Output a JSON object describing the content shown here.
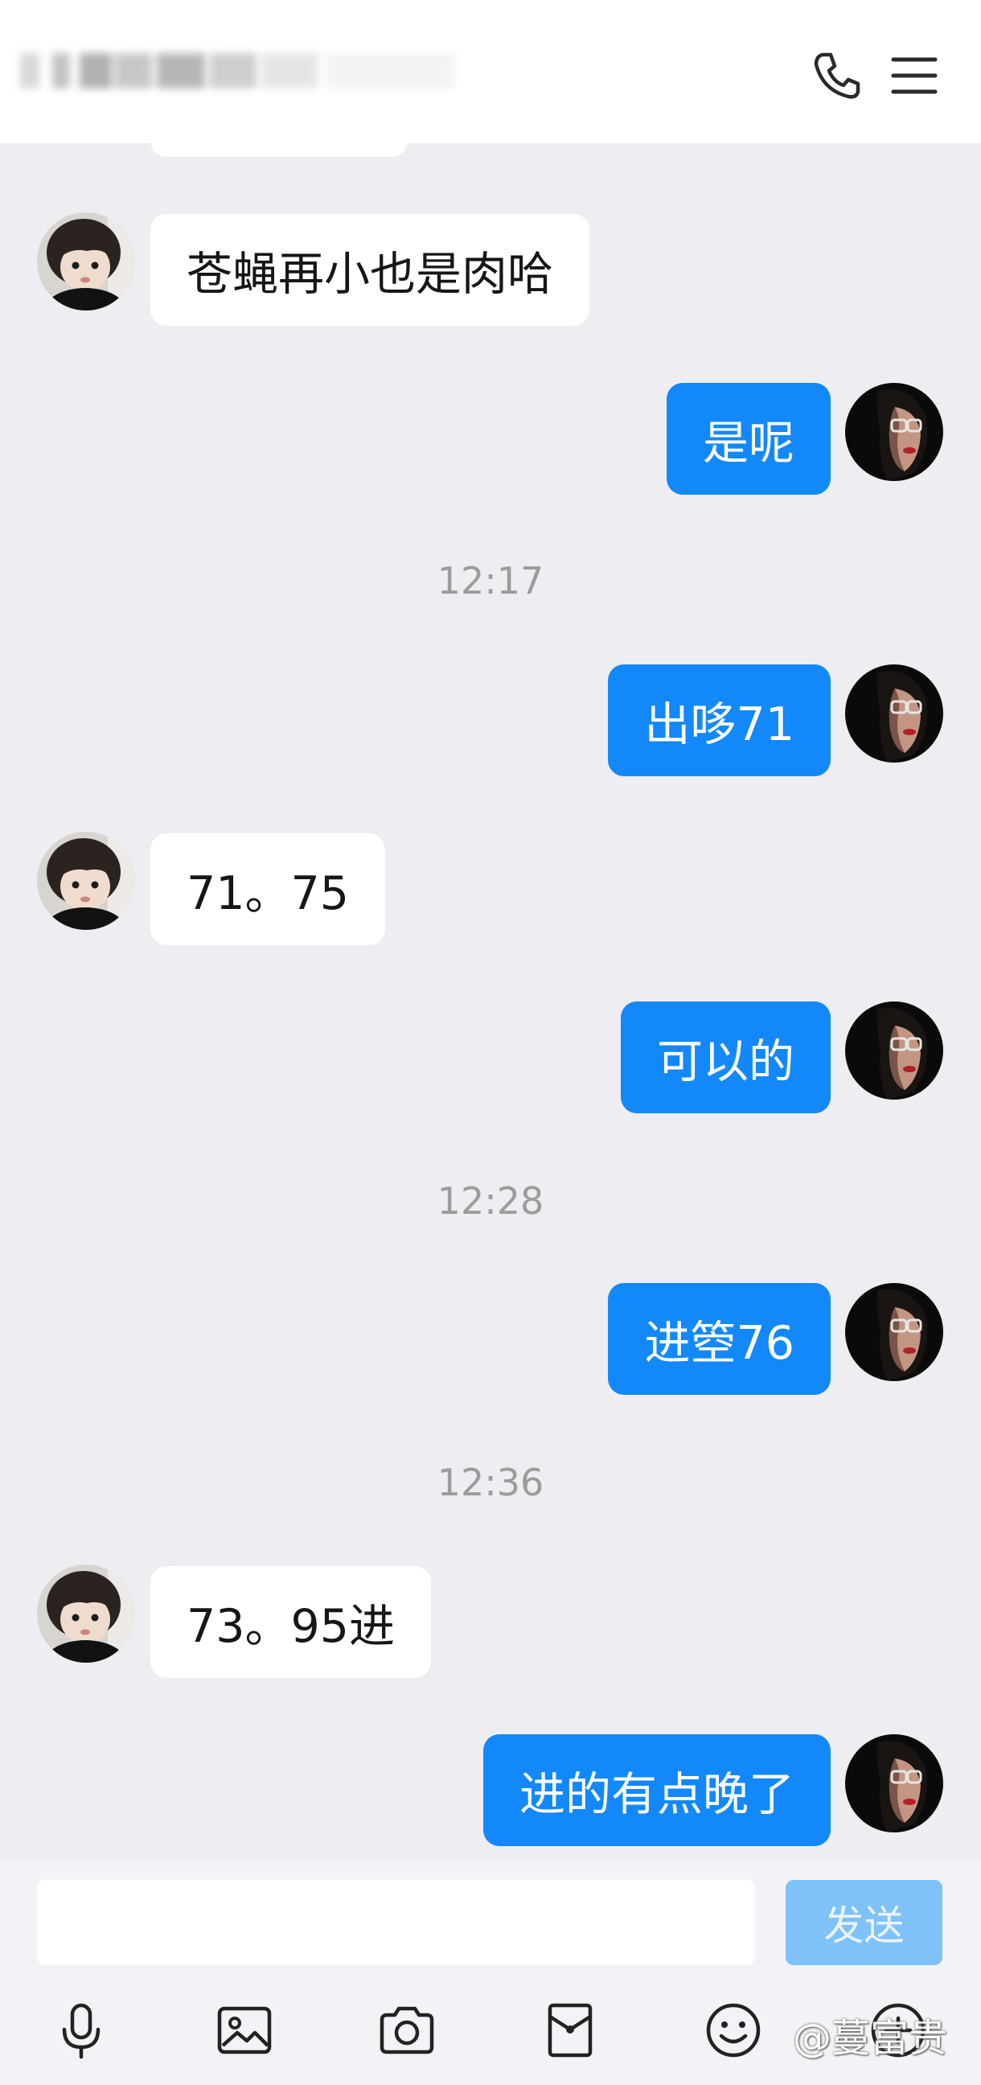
{
  "header": {
    "title_redacted": true,
    "phone_icon": "phone-icon",
    "menu_icon": "menu-icon"
  },
  "messages": [
    {
      "type": "partial",
      "side": "left",
      "text": ""
    },
    {
      "type": "message",
      "side": "left",
      "text": "苍蝇再小也是肉哈"
    },
    {
      "type": "message",
      "side": "right",
      "text": "是呢"
    },
    {
      "type": "time",
      "text": "12:17"
    },
    {
      "type": "message",
      "side": "right",
      "text": "出哆71"
    },
    {
      "type": "message",
      "side": "left",
      "text": "71。75"
    },
    {
      "type": "message",
      "side": "right",
      "text": "可以的"
    },
    {
      "type": "time",
      "text": "12:28"
    },
    {
      "type": "message",
      "side": "right",
      "text": "进箜76"
    },
    {
      "type": "time",
      "text": "12:36"
    },
    {
      "type": "message",
      "side": "left",
      "text": "73。95进"
    },
    {
      "type": "message",
      "side": "right",
      "text": "进的有点晚了"
    }
  ],
  "composer": {
    "input_value": "",
    "send_label": "发送"
  },
  "toolbar": {
    "icons": [
      "microphone-icon",
      "image-icon",
      "camera-icon",
      "red-packet-icon",
      "emoji-icon",
      "plus-icon"
    ]
  },
  "watermark": "@蔓富贵",
  "colors": {
    "chat_bg": "#EDEDF2",
    "right_bubble": "#1388FA",
    "left_bubble": "#FFFFFF",
    "send_button": "#7EC2F9"
  }
}
